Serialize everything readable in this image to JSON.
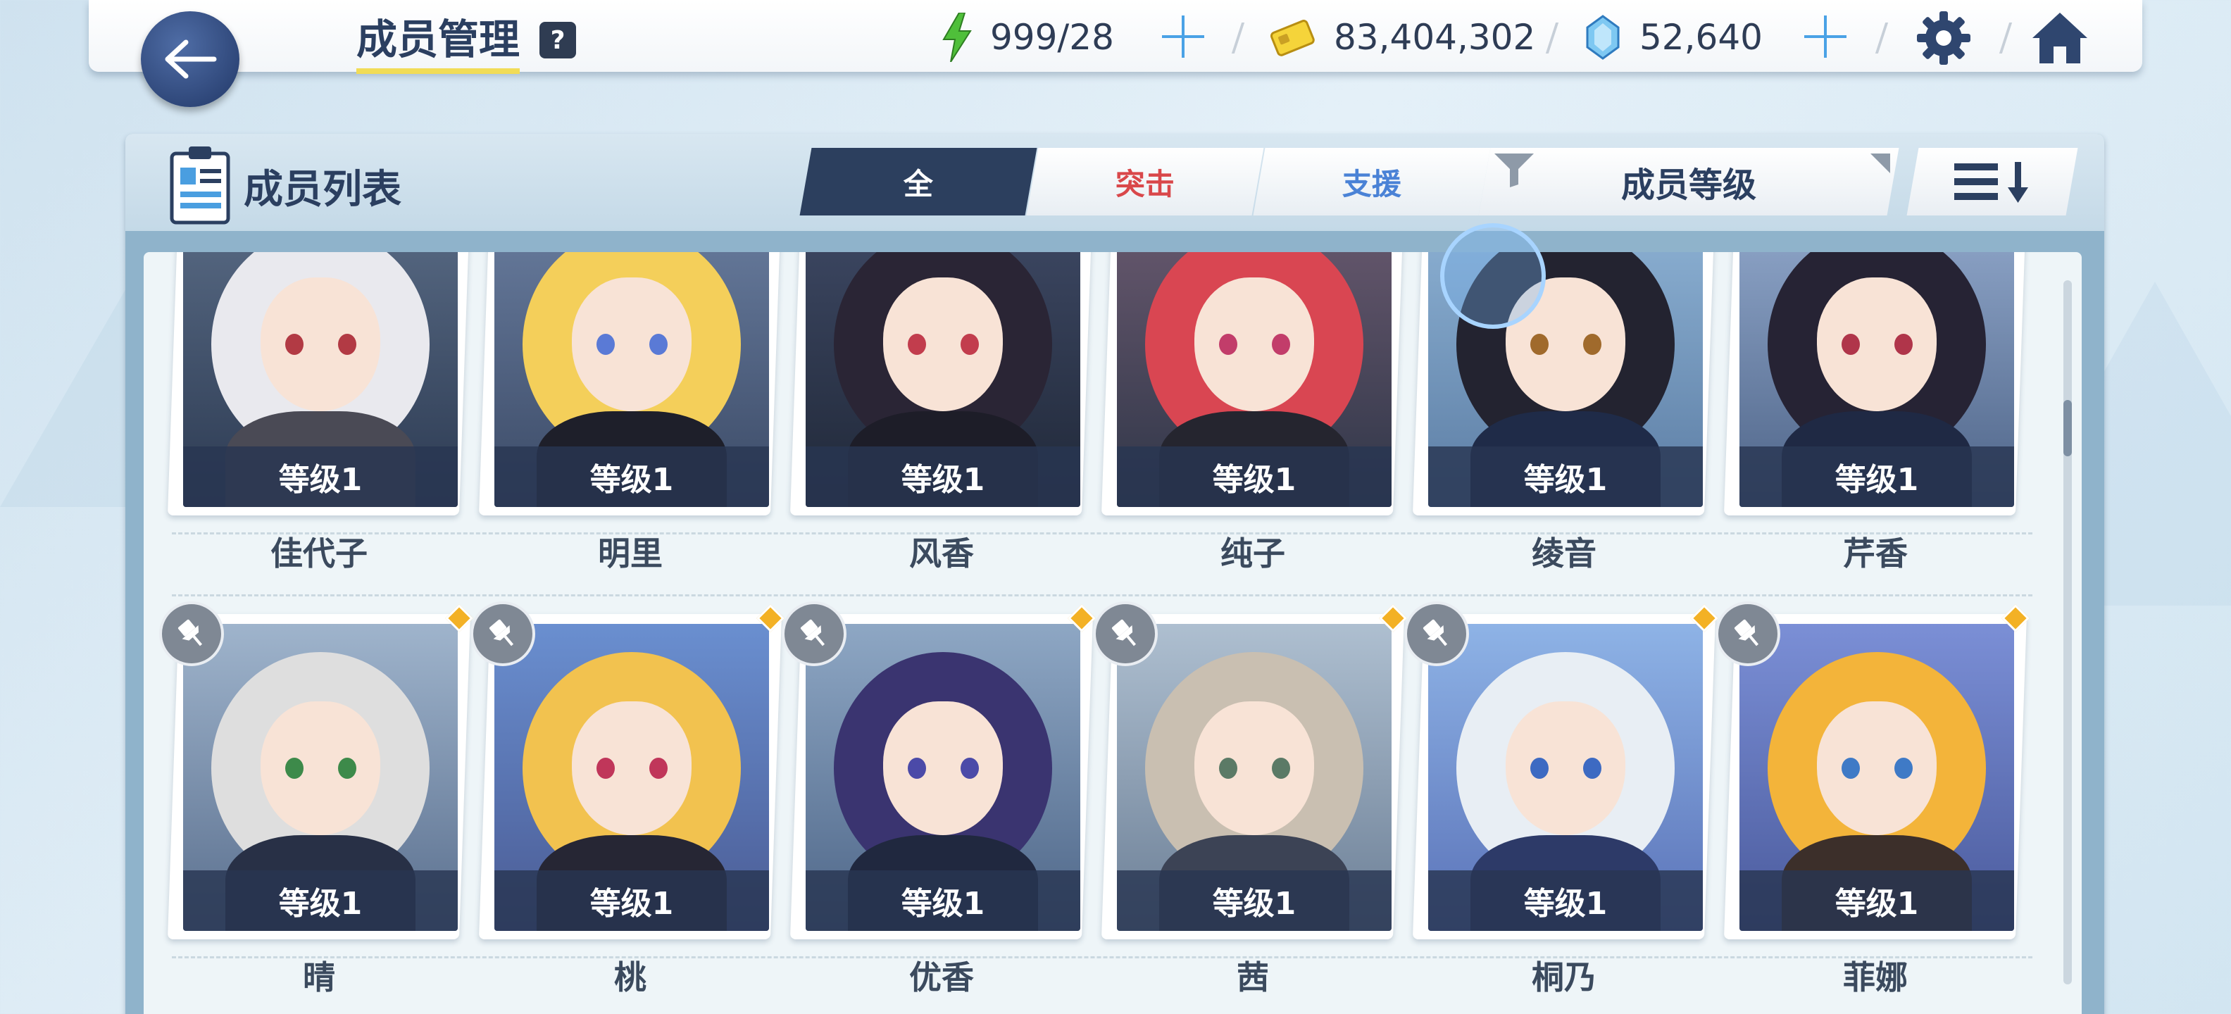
{
  "header": {
    "title": "成员管理",
    "help_label": "?",
    "stamina": "999/28",
    "credits": "83,404,302",
    "gems": "52,640"
  },
  "panel": {
    "title": "成员列表",
    "tabs": [
      {
        "label": "全",
        "color": "#ffffff"
      },
      {
        "label": "突击",
        "color": "#d9474a"
      },
      {
        "label": "支援",
        "color": "#4a82d6"
      }
    ],
    "sort_label": "成员等级"
  },
  "rows": [
    {
      "members": [
        {
          "name": "佳代子",
          "level": "等级1"
        },
        {
          "name": "明里",
          "level": "等级1"
        },
        {
          "name": "风香",
          "level": "等级1"
        },
        {
          "name": "纯子",
          "level": "等级1"
        },
        {
          "name": "绫音",
          "level": "等级1"
        },
        {
          "name": "芹香",
          "level": "等级1"
        }
      ]
    },
    {
      "members": [
        {
          "name": "晴",
          "level": "等级1"
        },
        {
          "name": "桃",
          "level": "等级1"
        },
        {
          "name": "优香",
          "level": "等级1"
        },
        {
          "name": "茜",
          "level": "等级1"
        },
        {
          "name": "桐乃",
          "level": "等级1"
        },
        {
          "name": "菲娜",
          "level": "等级1"
        }
      ]
    }
  ],
  "colors": {
    "accent_dark": "#2c3f5e",
    "plus_blue": "#4aa2e6",
    "title_underline": "#f1dc57"
  },
  "icons": [
    "back-arrow-icon",
    "stamina-bolt-icon",
    "credit-card-icon",
    "gem-icon",
    "gear-icon",
    "home-icon",
    "member-list-icon",
    "filter-icon",
    "sort-order-icon",
    "pin-icon"
  ]
}
